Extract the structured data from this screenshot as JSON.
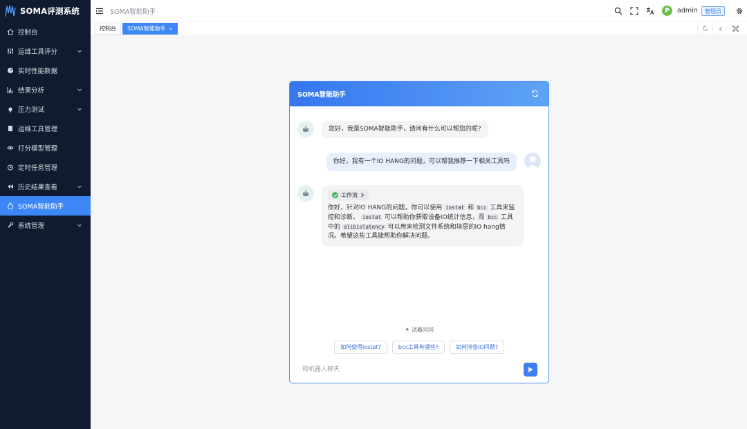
{
  "app": {
    "title": "SOMA评测系统"
  },
  "sidebar": {
    "items": [
      {
        "label": "控制台",
        "icon": "home-icon",
        "has_children": false
      },
      {
        "label": "运维工具评分",
        "icon": "sliders-icon",
        "has_children": true
      },
      {
        "label": "实时性能数据",
        "icon": "gauge-icon",
        "has_children": false
      },
      {
        "label": "结果分析",
        "icon": "bar-chart-icon",
        "has_children": true
      },
      {
        "label": "压力测试",
        "icon": "bell-icon",
        "has_children": true
      },
      {
        "label": "运维工具管理",
        "icon": "document-icon",
        "has_children": false
      },
      {
        "label": "打分模型管理",
        "icon": "eye-icon",
        "has_children": false
      },
      {
        "label": "定时任务管理",
        "icon": "alarm-icon",
        "has_children": false
      },
      {
        "label": "历史结果查看",
        "icon": "rewind-icon",
        "has_children": true
      },
      {
        "label": "SOMA智能助手",
        "icon": "drop-icon",
        "has_children": false,
        "active": true
      },
      {
        "label": "系统管理",
        "icon": "wrench-icon",
        "has_children": true
      }
    ]
  },
  "topbar": {
    "page_title": "SOMA智能助手",
    "user": {
      "avatar_letter": "P",
      "name": "admin",
      "role": "管理员"
    }
  },
  "tabs": [
    {
      "label": "控制台",
      "active": false
    },
    {
      "label": "SOMA智能助手",
      "active": true,
      "close": "×"
    }
  ],
  "chat": {
    "title": "SOMA智能助手",
    "messages": {
      "bot_greeting": "您好，我是SOMA智能助手，请问有什么可以帮您的呢?",
      "user_question": "你好，我有一个IO HANG的问题，可以帮我推荐一下相关工具吗",
      "workflow_label": "工作流",
      "reply": {
        "p1": "你好，针对IO HANG的问题，你可以使用",
        "c1": "iostat",
        "p2": "和",
        "c2": "bcc",
        "p3": "工具来监控和诊断。",
        "c3": "iostat",
        "p4": "可以帮助你获取设备IO统计信息，而",
        "c4": "bcc",
        "p5": "工具中的",
        "c5": "alibiolatency",
        "p6": "可以用来检测文件系统和块层的IO hang情况。希望这些工具能帮助你解决问题。"
      }
    },
    "try_ask": "试着问问",
    "suggestions": [
      "如何使用iostat?",
      "bcc工具有哪些?",
      "如何排查IO问题?"
    ],
    "input_placeholder": "和机器人聊天"
  },
  "colors": {
    "sidebar_bg": "#0f1b2e",
    "accent": "#3d86f6"
  }
}
